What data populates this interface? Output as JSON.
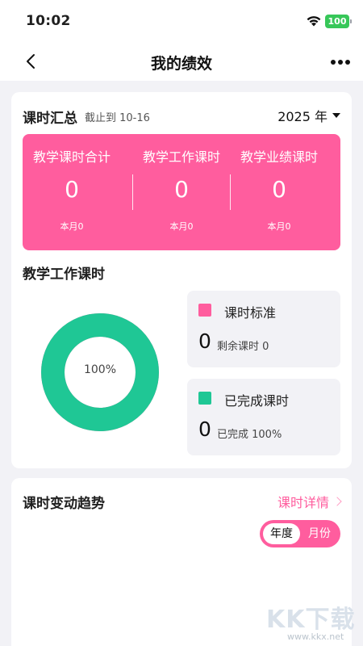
{
  "status_bar": {
    "time": "10:02",
    "battery": "100"
  },
  "nav": {
    "title": "我的绩效"
  },
  "summary": {
    "title": "课时汇总",
    "subtitle": "截止到 10-16",
    "year": "2025 年",
    "stats": [
      {
        "label": "教学课时合计",
        "value": "0",
        "month": "本月0"
      },
      {
        "label": "教学工作课时",
        "value": "0",
        "month": "本月0"
      },
      {
        "label": "教学业绩课时",
        "value": "0",
        "month": "本月0"
      }
    ]
  },
  "work_hours": {
    "title": "教学工作课时",
    "donut_percent_label": "100%",
    "completed_fraction": 1.0,
    "legend": [
      {
        "name": "课时标准",
        "number": "0",
        "note": "剩余课时 0",
        "color": "#ff5d9e"
      },
      {
        "name": "已完成课时",
        "number": "0",
        "note": "已完成 100%",
        "color": "#1fc795"
      }
    ]
  },
  "trend": {
    "title": "课时变动趋势",
    "detail_link": "课时详情",
    "toggle": {
      "year": "年度",
      "month": "月份",
      "selected": "年度"
    }
  },
  "watermark": {
    "text": "KK下载",
    "url": "www.kkx.net"
  },
  "colors": {
    "accent": "#ff5d9e",
    "green": "#1fc795",
    "background": "#f2f2f6"
  }
}
